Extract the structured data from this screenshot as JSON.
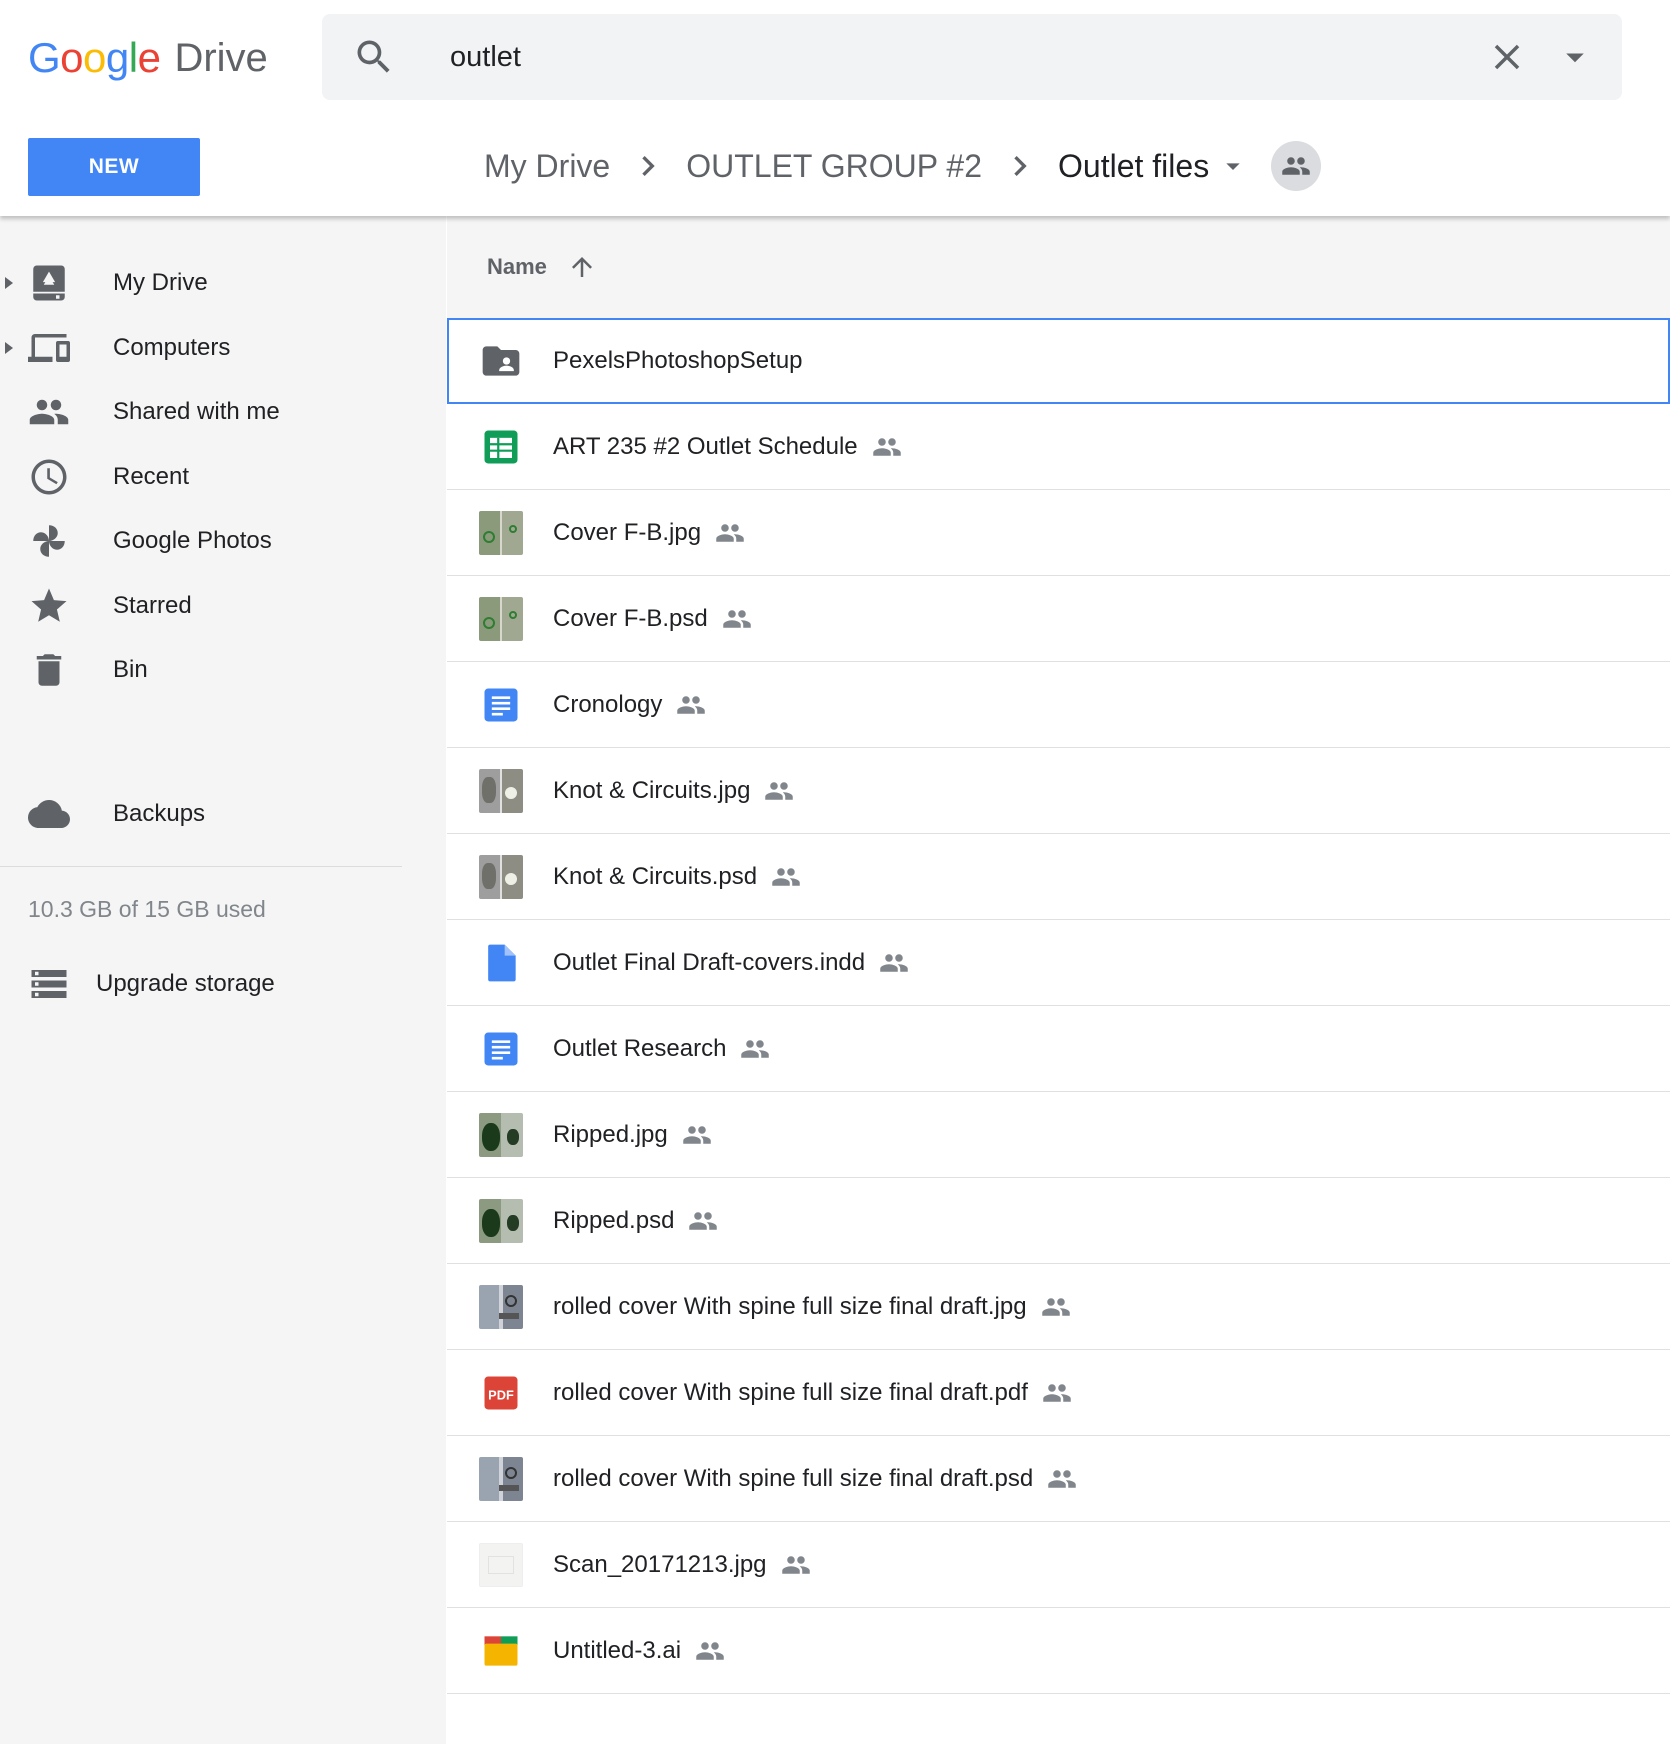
{
  "app": {
    "logo_letters": [
      "G",
      "o",
      "o",
      "g",
      "l",
      "e"
    ],
    "logo_colors": [
      "#4285f4",
      "#ea4335",
      "#fbbc05",
      "#4285f4",
      "#34a853",
      "#ea4335"
    ],
    "product": "Drive"
  },
  "search": {
    "value": "outlet",
    "icon": "search-icon",
    "clear_icon": "close-icon",
    "options_icon": "caret-down-icon"
  },
  "new_button": {
    "label": "NEW",
    "color": "#4285f4"
  },
  "breadcrumb": {
    "items": [
      "My Drive",
      "OUTLET GROUP #2"
    ],
    "current": "Outlet files",
    "shared_icon": "people-icon"
  },
  "sidebar": {
    "items": [
      {
        "label": "My Drive",
        "icon": "my-drive-icon",
        "expandable": true
      },
      {
        "label": "Computers",
        "icon": "computers-icon",
        "expandable": true
      },
      {
        "label": "Shared with me",
        "icon": "people-icon",
        "expandable": false
      },
      {
        "label": "Recent",
        "icon": "clock-icon",
        "expandable": false
      },
      {
        "label": "Google Photos",
        "icon": "pinwheel-icon",
        "expandable": false
      },
      {
        "label": "Starred",
        "icon": "star-icon",
        "expandable": false
      },
      {
        "label": "Bin",
        "icon": "trash-icon",
        "expandable": false
      }
    ],
    "backups": {
      "label": "Backups",
      "icon": "cloud-icon"
    },
    "storage_text": "10.3 GB of 15 GB used",
    "upgrade": {
      "label": "Upgrade storage",
      "icon": "storage-icon"
    }
  },
  "list": {
    "column_name": "Name",
    "sort_icon": "arrow-up-icon",
    "selection_color": "#4285f4",
    "files": [
      {
        "name": "PexelsPhotoshopSetup",
        "type": "shared-folder",
        "shared": false,
        "selected": true
      },
      {
        "name": "ART 235 #2 Outlet Schedule",
        "type": "sheet",
        "shared": true
      },
      {
        "name": "Cover F-B.jpg",
        "type": "image-cover",
        "shared": true
      },
      {
        "name": "Cover F-B.psd",
        "type": "image-cover",
        "shared": true
      },
      {
        "name": "Cronology",
        "type": "doc",
        "shared": true
      },
      {
        "name": "Knot & Circuits.jpg",
        "type": "image-knot",
        "shared": true
      },
      {
        "name": "Knot & Circuits.psd",
        "type": "image-knot",
        "shared": true
      },
      {
        "name": "Outlet Final Draft-covers.indd",
        "type": "file",
        "shared": true
      },
      {
        "name": "Outlet Research",
        "type": "doc",
        "shared": true
      },
      {
        "name": "Ripped.jpg",
        "type": "image-ripped",
        "shared": true
      },
      {
        "name": "Ripped.psd",
        "type": "image-ripped",
        "shared": true
      },
      {
        "name": "rolled cover With spine full size final draft.jpg",
        "type": "image-rolled",
        "shared": true
      },
      {
        "name": "rolled cover With spine full size final draft.pdf",
        "type": "pdf",
        "shared": true
      },
      {
        "name": "rolled cover With spine full size final draft.psd",
        "type": "image-rolled",
        "shared": true
      },
      {
        "name": "Scan_20171213.jpg",
        "type": "image-scan",
        "shared": true
      },
      {
        "name": "Untitled-3.ai",
        "type": "ai",
        "shared": true
      }
    ],
    "pdf_badge": "PDF"
  }
}
